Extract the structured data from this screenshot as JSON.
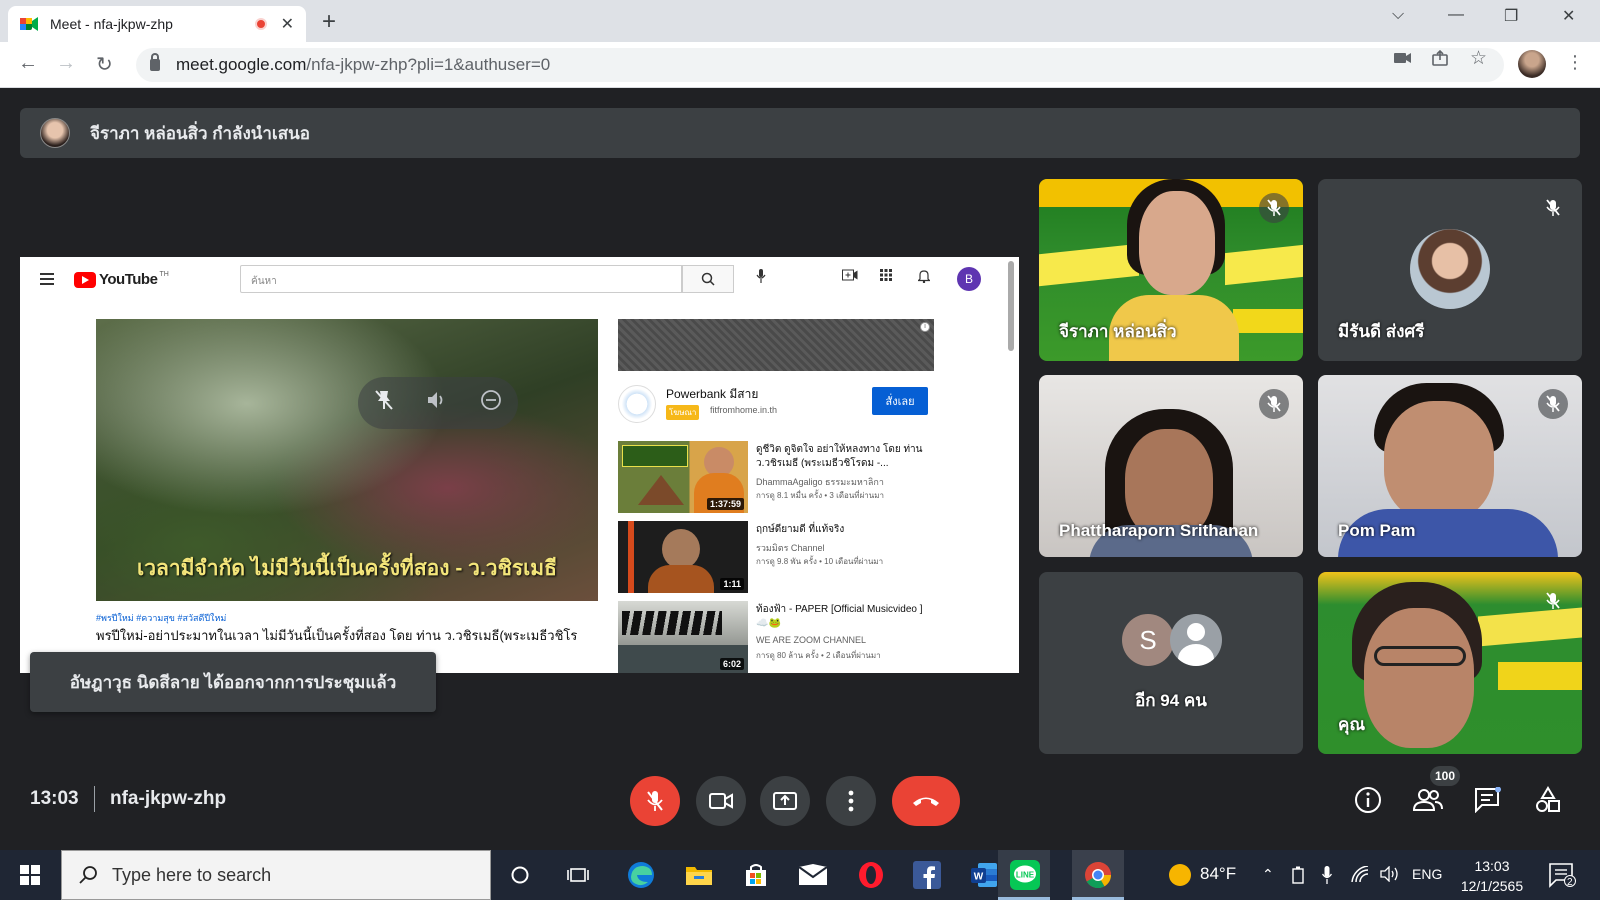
{
  "browser": {
    "tab_title": "Meet - nfa-jkpw-zhp",
    "new_tab": "+",
    "url_host": "meet.google.com",
    "url_path": "/nfa-jkpw-zhp?pli=1&authuser=0"
  },
  "meet": {
    "presenter_text": "จีราภา หล่อนสิ่ว กำลังนำเสนอ",
    "toast": "อัษฎาวุธ นิดสีลาย ได้ออกจากการประชุมแล้ว",
    "time": "13:03",
    "meeting_code": "nfa-jkpw-zhp",
    "participant_count": "100",
    "tiles": [
      {
        "name": "จีราภา หล่อนสิ่ว"
      },
      {
        "name": "มีรันดี ส่งศรี"
      },
      {
        "name": "Phattharaporn Srithanan"
      },
      {
        "name": "Pom Pam"
      },
      {
        "name": "อีก 94 คน",
        "initial": "S"
      },
      {
        "name": "คุณ"
      }
    ]
  },
  "youtube": {
    "logo_text": "YouTube",
    "region": "TH",
    "search_placeholder": "ค้นหา",
    "avatar_initial": "B",
    "caption": "เวลามีจำกัด ไม่มีวันนี้เป็นครั้งที่สอง - ว.วชิรเมธี",
    "tags": "#พรปีใหม่ #ความสุข #สวัสดีปีใหม่",
    "video_title": "พรปีใหม่-อย่าประมาทในเวลา ไม่มีวันนี้เป็นครั้งที่สอง โดย ท่าน ว.วชิรเมธี(พระเมธีวชิโร",
    "ad": {
      "name": "Powerbank มีสาย",
      "badge": "โฆษณา",
      "site": "fitfromhome.in.th",
      "cta": "สั่งเลย"
    },
    "recs": [
      {
        "title": "ดูชีวิต ดูจิตใจ อย่าให้หลงทาง โดย ท่าน ว.วชิรเมธี (พระเมธีวชิโรดม -...",
        "channel": "DhammaAgaligo ธรรมะมหาลิกา",
        "meta": "การดู 8.1 หมื่น ครั้ง • 3 เดือนที่ผ่านมา",
        "duration": "1:37:59"
      },
      {
        "title": "ฤกษ์ดียามดี ที่แท้จริง",
        "channel": "รวมมิตร Channel",
        "meta": "การดู 9.8 พัน ครั้ง • 10 เดือนที่ผ่านมา",
        "duration": "1:11"
      },
      {
        "title": "ท้องฟ้า - PAPER [Official Musicvideo ] ☁️🐸",
        "channel": "WE ARE ZOOM CHANNEL",
        "meta": "การดู 80 ล้าน ครั้ง • 2 เดือนที่ผ่านมา",
        "duration": "6:02"
      }
    ]
  },
  "taskbar": {
    "search_placeholder": "Type here to search",
    "temperature": "84°F",
    "lang": "ENG",
    "time": "13:03",
    "date": "12/1/2565",
    "notifications": "2"
  }
}
